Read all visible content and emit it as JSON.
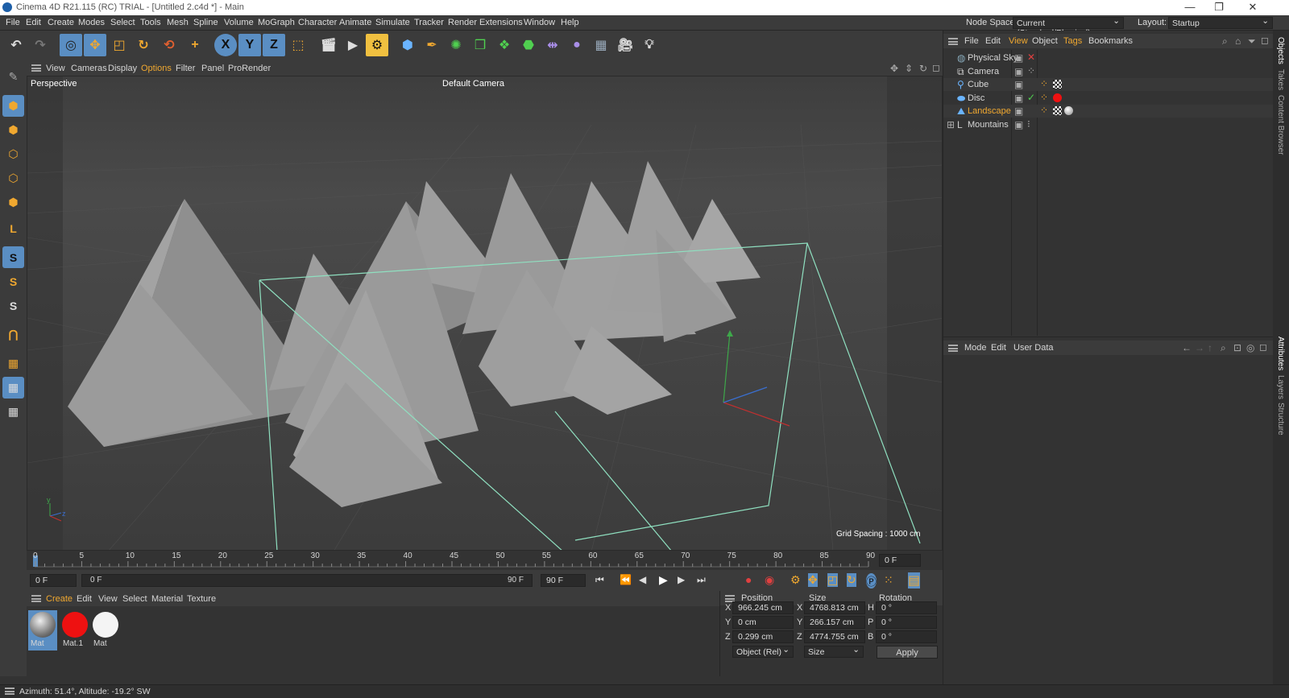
{
  "window": {
    "title": "Cinema 4D R21.115 (RC) TRIAL - [Untitled 2.c4d *] - Main",
    "minimize": "—",
    "restore": "❐",
    "close": "✕"
  },
  "menu": {
    "items": [
      "File",
      "Edit",
      "Create",
      "Modes",
      "Select",
      "Tools",
      "Mesh",
      "Spline",
      "Volume",
      "MoGraph",
      "Character",
      "Animate",
      "Simulate",
      "Tracker",
      "Render",
      "Extensions",
      "Window",
      "Help"
    ],
    "node_space_label": "Node Space:",
    "node_space_value": "Current (Standard/Physical)",
    "layout_label": "Layout:",
    "layout_value": "Startup"
  },
  "toolbar": {
    "axis_x": "X",
    "axis_y": "Y",
    "axis_z": "Z"
  },
  "viewport": {
    "menu": [
      "View",
      "Cameras",
      "Display",
      "Options",
      "Filter",
      "Panel",
      "ProRender"
    ],
    "view_name": "Perspective",
    "camera_name": "Default Camera",
    "grid_spacing": "Grid Spacing : 1000 cm",
    "axis_y": "y",
    "axis_z": "z"
  },
  "timeline": {
    "ticks": [
      "0",
      "5",
      "10",
      "15",
      "20",
      "25",
      "30",
      "35",
      "40",
      "45",
      "50",
      "55",
      "60",
      "65",
      "70",
      "75",
      "80",
      "85",
      "90"
    ],
    "frame_end_field": "0 F",
    "current_frame": "0 F",
    "range_start": "0 F",
    "range_end": "90 F",
    "max_frame": "90 F"
  },
  "material_manager": {
    "menu": [
      "Create",
      "Edit",
      "View",
      "Select",
      "Material",
      "Texture"
    ],
    "materials": [
      {
        "name": "Mat",
        "color": "#9a9a9a"
      },
      {
        "name": "Mat.1",
        "color": "#ee1111"
      },
      {
        "name": "Mat",
        "color": "#f4f4f4"
      }
    ]
  },
  "coordinates": {
    "position_header": "Position",
    "size_header": "Size",
    "rotation_header": "Rotation",
    "rows": [
      {
        "axis": "X",
        "pos": "966.245 cm",
        "size_axis": "X",
        "size": "4768.813 cm",
        "rot_axis": "H",
        "rot": "0 °"
      },
      {
        "axis": "Y",
        "pos": "0 cm",
        "size_axis": "Y",
        "size": "266.157 cm",
        "rot_axis": "P",
        "rot": "0 °"
      },
      {
        "axis": "Z",
        "pos": "0.299 cm",
        "size_axis": "Z",
        "size": "4774.755 cm",
        "rot_axis": "B",
        "rot": "0 °"
      }
    ],
    "mode_value": "Object (Rel)",
    "size_mode_value": "Size",
    "apply_label": "Apply"
  },
  "object_manager": {
    "menu": [
      "File",
      "Edit",
      "View",
      "Object",
      "Tags",
      "Bookmarks"
    ],
    "objects": [
      {
        "name": "Physical Sky",
        "highlight": false
      },
      {
        "name": "Camera",
        "highlight": false
      },
      {
        "name": "Cube",
        "highlight": false
      },
      {
        "name": "Disc",
        "highlight": false
      },
      {
        "name": "Landscape",
        "highlight": true
      },
      {
        "name": "Mountains",
        "highlight": false
      }
    ]
  },
  "attribute_manager": {
    "menu": [
      "Mode",
      "Edit",
      "User Data"
    ]
  },
  "side_tabs": {
    "objects": "Objects",
    "takes": "Takes",
    "content_browser": "Content Browser",
    "attributes": "Attributes",
    "layers": "Layers",
    "structure": "Structure"
  },
  "status": {
    "text": "Azimuth: 51.4°, Altitude: -19.2°  SW"
  },
  "colors": {
    "selection_blue": "#5a8ec3",
    "highlight_orange": "#f0a830",
    "camera_frame": "#8fe0c0"
  }
}
